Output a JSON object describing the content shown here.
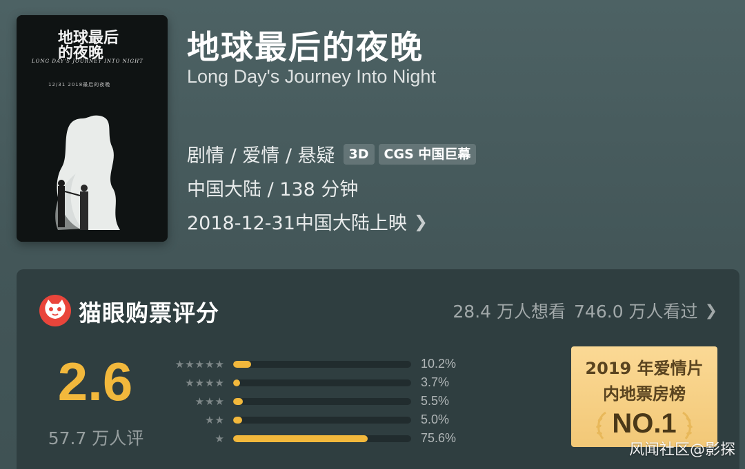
{
  "movie": {
    "title": "地球最后的夜晚",
    "subtitle": "Long Day's Journey Into Night",
    "genres": "剧情 / 爱情 / 悬疑",
    "tags": [
      "3D",
      "CGS 中国巨幕"
    ],
    "region_duration": "中国大陆 / 138 分钟",
    "release": "2018-12-31中国大陆上映",
    "poster": {
      "title_text": "地球最后的夜晚",
      "en_text": "LONG DAY'S JOURNEY INTO NIGHT",
      "date_text": "12/31 2018最后的夜晚"
    }
  },
  "rating": {
    "section_title": "猫眼购票评分",
    "want_to_see": "28.4 万人想看",
    "watched": "746.0 万人看过",
    "score": "2.6",
    "rating_count": "57.7 万人评",
    "distribution": [
      {
        "stars": 5,
        "percent_label": "10.2%",
        "value": 10.2
      },
      {
        "stars": 4,
        "percent_label": "3.7%",
        "value": 3.7
      },
      {
        "stars": 3,
        "percent_label": "5.5%",
        "value": 5.5
      },
      {
        "stars": 2,
        "percent_label": "5.0%",
        "value": 5.0
      },
      {
        "stars": 1,
        "percent_label": "75.6%",
        "value": 75.6
      }
    ],
    "badge": {
      "line1": "2019 年爱情片",
      "line2": "内地票房榜",
      "rank": "NO.1"
    }
  },
  "watermark": "风闻社区@影探",
  "colors": {
    "accent": "#f2b83c",
    "badge_bg": "#f7d085",
    "card_bg": "#2f3e40"
  }
}
